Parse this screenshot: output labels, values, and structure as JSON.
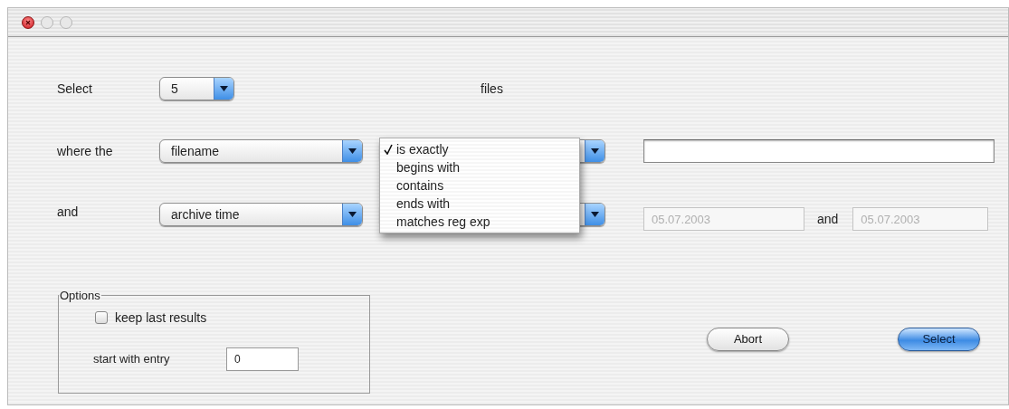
{
  "select_row": {
    "label": "Select",
    "count_popup": "5",
    "unit": "files"
  },
  "where_row": {
    "label": "where the",
    "field_popup": "filename",
    "operator_menu": {
      "expanded": true,
      "items": [
        {
          "label": "is exactly",
          "selected": true
        },
        {
          "label": "begins with",
          "selected": false
        },
        {
          "label": "contains",
          "selected": false
        },
        {
          "label": "ends with",
          "selected": false
        },
        {
          "label": "matches reg exp",
          "selected": false
        }
      ]
    }
  },
  "and_row": {
    "label": "and",
    "field_popup": "archive time",
    "from_date": {
      "value": "05.07.2003",
      "disabled": true
    },
    "joiner": "and",
    "to_date": {
      "value": "05.07.2003",
      "disabled": true
    }
  },
  "options": {
    "title": "Options",
    "keep_last_results": {
      "label": "keep last results",
      "checked": false
    },
    "start_entry": {
      "label": "start with entry",
      "value": "0"
    }
  },
  "buttons": [
    {
      "label": "Abort",
      "default": false
    },
    {
      "label": "Select",
      "default": true
    }
  ]
}
